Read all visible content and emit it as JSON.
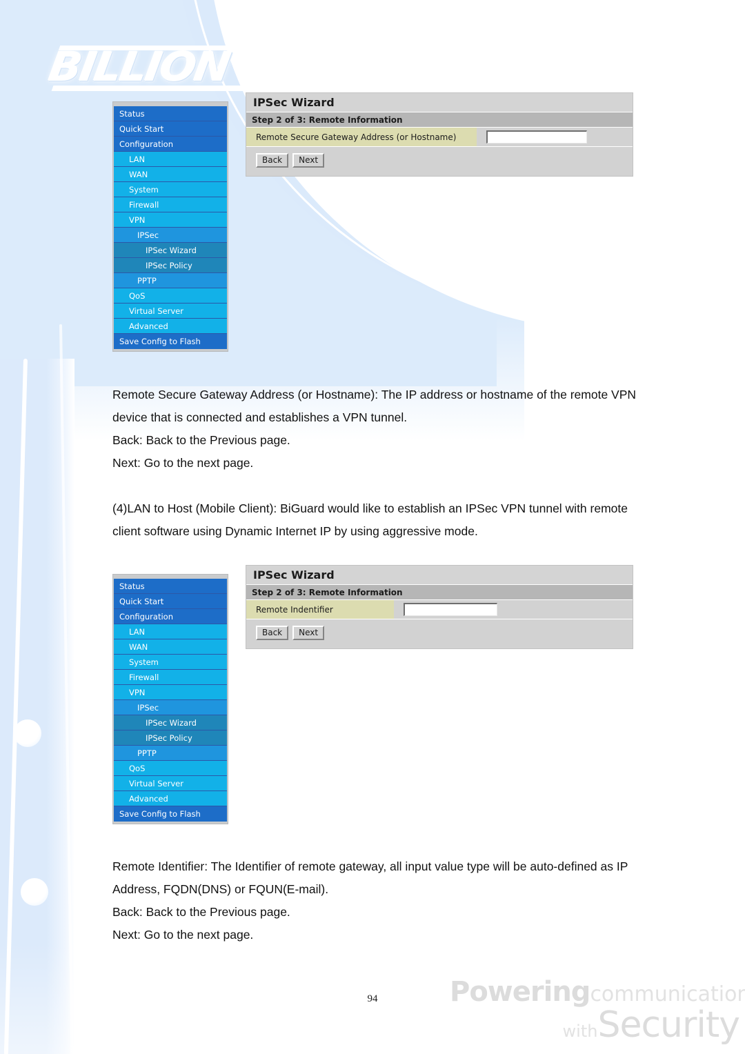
{
  "brand": {
    "logo_text": "BILLION",
    "tagline_line1_bold": "Powering",
    "tagline_line1_light": "communications",
    "tagline_line2_small": "with",
    "tagline_line2_big": "Security"
  },
  "page": {
    "number": "94"
  },
  "nav": {
    "items": [
      {
        "label": "Status",
        "level": 0
      },
      {
        "label": "Quick Start",
        "level": 0
      },
      {
        "label": "Configuration",
        "level": 0
      },
      {
        "label": "LAN",
        "level": 1
      },
      {
        "label": "WAN",
        "level": 1
      },
      {
        "label": "System",
        "level": 1
      },
      {
        "label": "Firewall",
        "level": 1
      },
      {
        "label": "VPN",
        "level": 1
      },
      {
        "label": "IPSec",
        "level": 2
      },
      {
        "label": "IPSec Wizard",
        "level": 3
      },
      {
        "label": "IPSec Policy",
        "level": 3
      },
      {
        "label": "PPTP",
        "level": 2
      },
      {
        "label": "QoS",
        "level": 1
      },
      {
        "label": "Virtual Server",
        "level": 1
      },
      {
        "label": "Advanced",
        "level": 1
      },
      {
        "label": "Save Config to Flash",
        "level": 0
      }
    ]
  },
  "panel_one": {
    "title": "IPSec Wizard",
    "step": "Step 2 of 3: Remote Information",
    "field_label": "Remote Secure Gateway Address (or Hostname)",
    "field_value": "",
    "back_label": "Back",
    "next_label": "Next"
  },
  "panel_two": {
    "title": "IPSec Wizard",
    "step": "Step 2 of 3: Remote Information",
    "field_label": "Remote Indentifier",
    "field_value": "",
    "back_label": "Back",
    "next_label": "Next"
  },
  "body": {
    "block_one_p1": "Remote Secure Gateway Address (or Hostname): The IP address or hostname of the remote VPN device that is connected and establishes a VPN tunnel.",
    "block_one_p2": "Back: Back to the Previous page.",
    "block_one_p3": "Next: Go to the next page.",
    "block_two_p1": "(4)LAN to Host (Mobile Client): BiGuard would like to establish an IPSec VPN tunnel with remote client software using Dynamic Internet IP by using aggressive mode.",
    "block_three_p1": "Remote Identifier: The Identifier of remote gateway, all input value type will be auto-defined as IP Address, FQDN(DNS) or FQUN(E-mail).",
    "block_three_p2": "Back: Back to the Previous page.",
    "block_three_p3": "Next: Go to the next page."
  },
  "colors": {
    "nav_level0": "#1d6dc8",
    "nav_level1": "#12b1e8",
    "nav_level2": "#1f95de",
    "nav_level3": "#1f86b9",
    "panel_title_bg": "#d4d4d4",
    "panel_step_bg": "#b6b6b6",
    "row_label_bg": "#dcdcb0",
    "page_bg_accent": "#dcebfb"
  }
}
